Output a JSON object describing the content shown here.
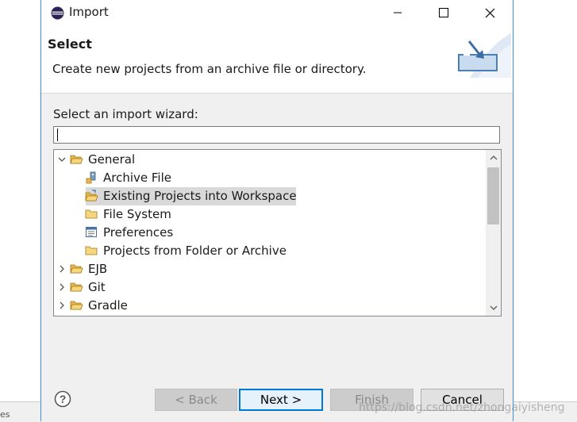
{
  "background": {
    "bottom_text": "es"
  },
  "window": {
    "title": "Import",
    "minimize_label": "minimize",
    "maximize_label": "maximize",
    "close_label": "close"
  },
  "header": {
    "title": "Select",
    "description": "Create new projects from an archive file or directory."
  },
  "wizard": {
    "label": "Select an import wizard:",
    "filter_value": "",
    "tree": [
      {
        "label": "General",
        "expanded": true,
        "level": 0,
        "icon": "folder-open-icon"
      },
      {
        "label": "Archive File",
        "level": 1,
        "icon": "archive-file-icon"
      },
      {
        "label": "Existing Projects into Workspace",
        "level": 1,
        "icon": "existing-projects-icon",
        "selected": true
      },
      {
        "label": "File System",
        "level": 1,
        "icon": "folder-icon"
      },
      {
        "label": "Preferences",
        "level": 1,
        "icon": "preferences-icon"
      },
      {
        "label": "Projects from Folder or Archive",
        "level": 1,
        "icon": "folder-icon"
      },
      {
        "label": "EJB",
        "expanded": false,
        "level": 0,
        "icon": "folder-open-icon"
      },
      {
        "label": "Git",
        "expanded": false,
        "level": 0,
        "icon": "folder-open-icon"
      },
      {
        "label": "Gradle",
        "expanded": false,
        "level": 0,
        "icon": "folder-open-icon"
      }
    ]
  },
  "buttons": {
    "back": "< Back",
    "next": "Next >",
    "finish": "Finish",
    "cancel": "Cancel"
  },
  "watermark": "https://blog.csdn.net/zhongaiyisheng",
  "colors": {
    "accent": "#0078d7",
    "selection": "#d9d9d9",
    "dialog_bg": "#f0f0f0",
    "border": "#3c8fd8"
  }
}
